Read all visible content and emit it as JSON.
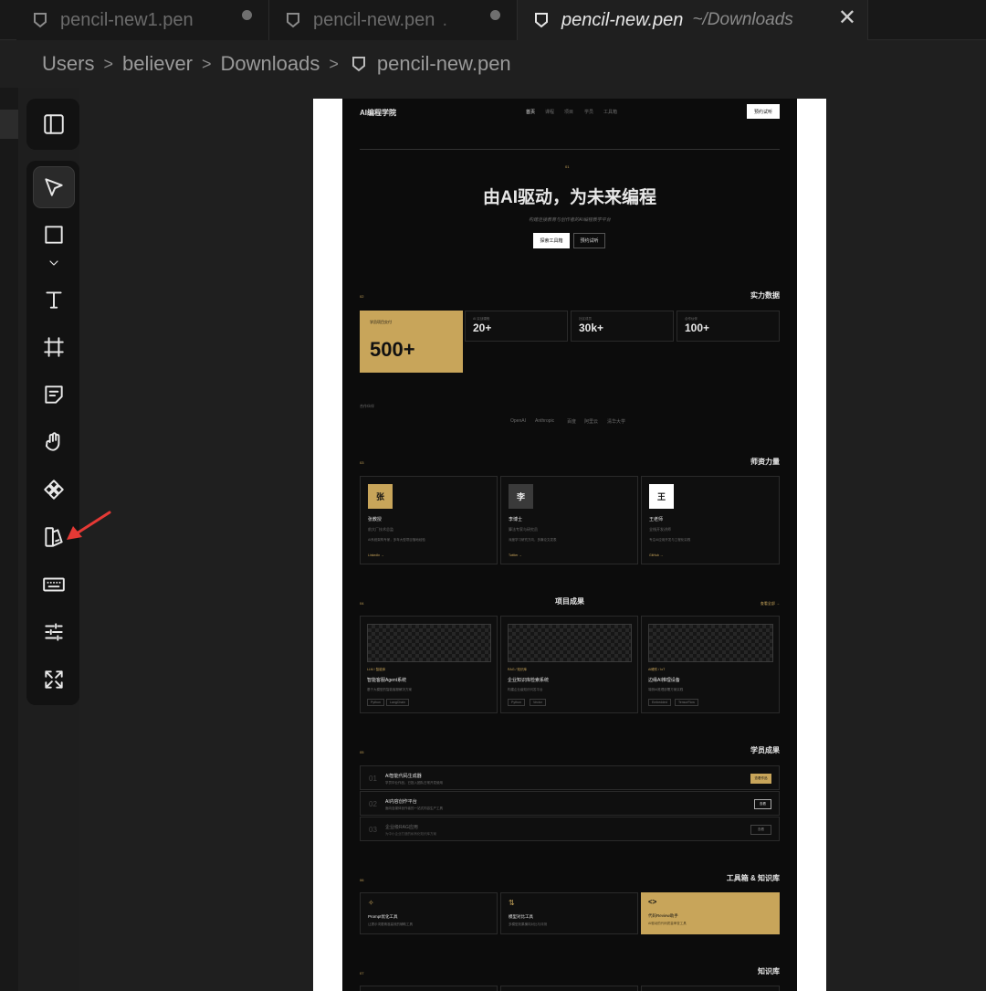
{
  "tabs": [
    {
      "label": "pencil-new1.pen",
      "dirty": true
    },
    {
      "label": "pencil-new.pen",
      "dirty": true
    },
    {
      "label": "pencil-new.pen",
      "description": "~/Downloads",
      "active": true
    }
  ],
  "breadcrumb": [
    "Users",
    "believer",
    "Downloads",
    "pencil-new.pen"
  ],
  "toolbar": {
    "icons": [
      "sidebar-toggle-icon",
      "pointer-icon",
      "rectangle-icon",
      "chevron-down-icon",
      "text-icon",
      "frame-icon",
      "sticky-note-icon",
      "hand-icon",
      "component-icon",
      "style-guide-icon",
      "keyboard-icon",
      "sliders-icon",
      "fullscreen-icon"
    ]
  },
  "annotation": {
    "color": "#e53935"
  },
  "site": {
    "logo": "AI编程学院",
    "nav": [
      "首页",
      "课程",
      "项目",
      "学员",
      "工具箱"
    ],
    "cta": "预约试听",
    "hero_index": "01",
    "hero_title": "由AI驱动，为未来编程",
    "hero_sub": "构建连接教育与创作者的AI编程教学平台",
    "hero_btn_primary": "探索工具箱",
    "hero_btn_secondary": "预约试听",
    "stats": {
      "index": "02",
      "title": "实力数据",
      "items": [
        {
          "label": "学员项目交付",
          "value": "500+"
        },
        {
          "label": "AI 实战课程",
          "value": "20+"
        },
        {
          "label": "社区成员",
          "value": "30k+"
        },
        {
          "label": "合作伙伴",
          "value": "100+"
        }
      ],
      "partners_label": "合作伙伴",
      "partners": [
        "OpenAI",
        "Anthropic",
        "百度",
        "阿里云",
        "清华大学"
      ]
    },
    "teachers": {
      "index": "03",
      "title": "师资力量",
      "items": [
        {
          "avatar": "张",
          "name": "张教授",
          "role": "前大厂技术总监",
          "desc": "AI系统架构专家，多年大型项目落地经验",
          "link": "LinkedIn →"
        },
        {
          "avatar": "李",
          "name": "李博士",
          "role": "算法专家与研究员",
          "desc": "深度学习研究方向，多篇论文发表",
          "link": "Twitter →"
        },
        {
          "avatar": "王",
          "name": "王老师",
          "role": "全栈开发讲师",
          "desc": "专注AI应用开发与工程化实践",
          "link": "GitHub →"
        }
      ]
    },
    "projects": {
      "index": "04",
      "title": "项目成果",
      "more": "查看全部 →",
      "items": [
        {
          "tag": "LLM / 智能体",
          "name": "智能客服Agent系统",
          "desc": "基于大模型的智能客服解决方案",
          "chips": [
            "Python",
            "LangChain"
          ]
        },
        {
          "tag": "RAG / 知识库",
          "name": "企业知识库检索系统",
          "desc": "构建企业级知识问答平台",
          "chips": [
            "Python",
            "Vector"
          ]
        },
        {
          "tag": "AI硬件 / IoT",
          "name": "边缘AI推理设备",
          "desc": "端侧AI推理部署方案实践",
          "chips": [
            "Embedded",
            "TensorFlow"
          ]
        }
      ]
    },
    "students": {
      "index": "05",
      "title": "学员成果",
      "items": [
        {
          "num": "01",
          "title": "AI智能代码生成器",
          "desc": "学员毕业作品，已投入团队日常开发使用",
          "btn": "查看作品"
        },
        {
          "num": "02",
          "title": "AI内容创作平台",
          "desc": "面向自媒体创作者的一站式内容生产工具",
          "btn": "查看"
        },
        {
          "num": "03",
          "title": "企业级RAG应用",
          "desc": "为中小企业打造的私有化知识库方案",
          "btn": "查看"
        }
      ]
    },
    "toolbox": {
      "index": "06",
      "title": "工具箱 & 知识库",
      "items": [
        {
          "name": "Prompt优化工具",
          "desc": "让提示词更精准高效的辅助工具"
        },
        {
          "name": "模型对比工具",
          "desc": "多模型效果横向对比与评测"
        },
        {
          "name": "代码Review助手",
          "desc": "AI驱动的代码质量审查工具"
        }
      ]
    },
    "knowledge": {
      "index": "07",
      "title": "知识库"
    }
  }
}
